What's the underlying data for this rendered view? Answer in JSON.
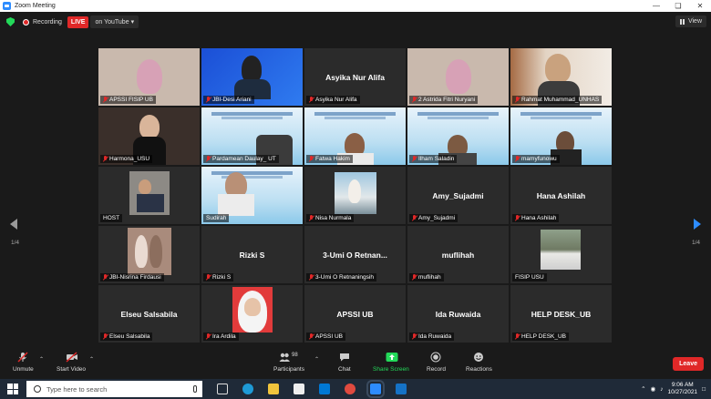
{
  "window": {
    "title": "Zoom Meeting"
  },
  "topbar": {
    "recording": "Recording",
    "live": "LIVE",
    "stream": "on YouTube",
    "view": "View"
  },
  "grid": {
    "page_left": "1/4",
    "page_right": "1/4",
    "tiles": [
      {
        "label": "APSSI FISIP UB",
        "center": ""
      },
      {
        "label": "JBI-Desi Ariani",
        "center": ""
      },
      {
        "label": "Asyika Nur Alifa",
        "center": "Asyika Nur Alifa"
      },
      {
        "label": "2 Astrida Fitri Nuryani",
        "center": ""
      },
      {
        "label": "Rahmat Muhammad_UNHAS",
        "center": ""
      },
      {
        "label": "Harmona_USU",
        "center": ""
      },
      {
        "label": "Pardamean Daulay_ UT",
        "center": ""
      },
      {
        "label": "Fatwa Hakim",
        "center": ""
      },
      {
        "label": "Ilham Saladin",
        "center": ""
      },
      {
        "label": "mamyfunowu",
        "center": ""
      },
      {
        "label": "HOST",
        "center": ""
      },
      {
        "label": "Sudirah",
        "center": ""
      },
      {
        "label": "Nisa Nurmala",
        "center": ""
      },
      {
        "label": "Amy_Sujadmi",
        "center": "Amy_Sujadmi"
      },
      {
        "label": "Hana Ashilah",
        "center": "Hana Ashilah"
      },
      {
        "label": "JBI-Nisrina Firdausi",
        "center": ""
      },
      {
        "label": "Rizki S",
        "center": "Rizki S"
      },
      {
        "label": "3-Umi O Retnaningsih",
        "center": "3-Umi O Retnan..."
      },
      {
        "label": "muflihah",
        "center": "muflihah"
      },
      {
        "label": "FISIP USU",
        "center": ""
      },
      {
        "label": "Elseu Salsabila",
        "center": "Elseu Salsabila"
      },
      {
        "label": "Ira Ardila",
        "center": ""
      },
      {
        "label": "APSSI UB",
        "center": "APSSI UB"
      },
      {
        "label": "Ida Ruwaida",
        "center": "Ida Ruwaida"
      },
      {
        "label": "HELP DESK_UB",
        "center": "HELP DESK_UB"
      }
    ]
  },
  "toolbar": {
    "unmute": "Unmute",
    "stop_video": "Start Video",
    "participants": "Participants",
    "participants_count": "98",
    "chat": "Chat",
    "share": "Share Screen",
    "record": "Record",
    "reactions": "Reactions",
    "leave": "Leave"
  },
  "taskbar": {
    "search_placeholder": "Type here to search",
    "time": "9:06 AM",
    "date": "10/27/2021"
  },
  "colors": {
    "accent": "#2d8cff",
    "danger": "#e02828",
    "share_green": "#23d959",
    "active_border": "#d9e33a"
  }
}
